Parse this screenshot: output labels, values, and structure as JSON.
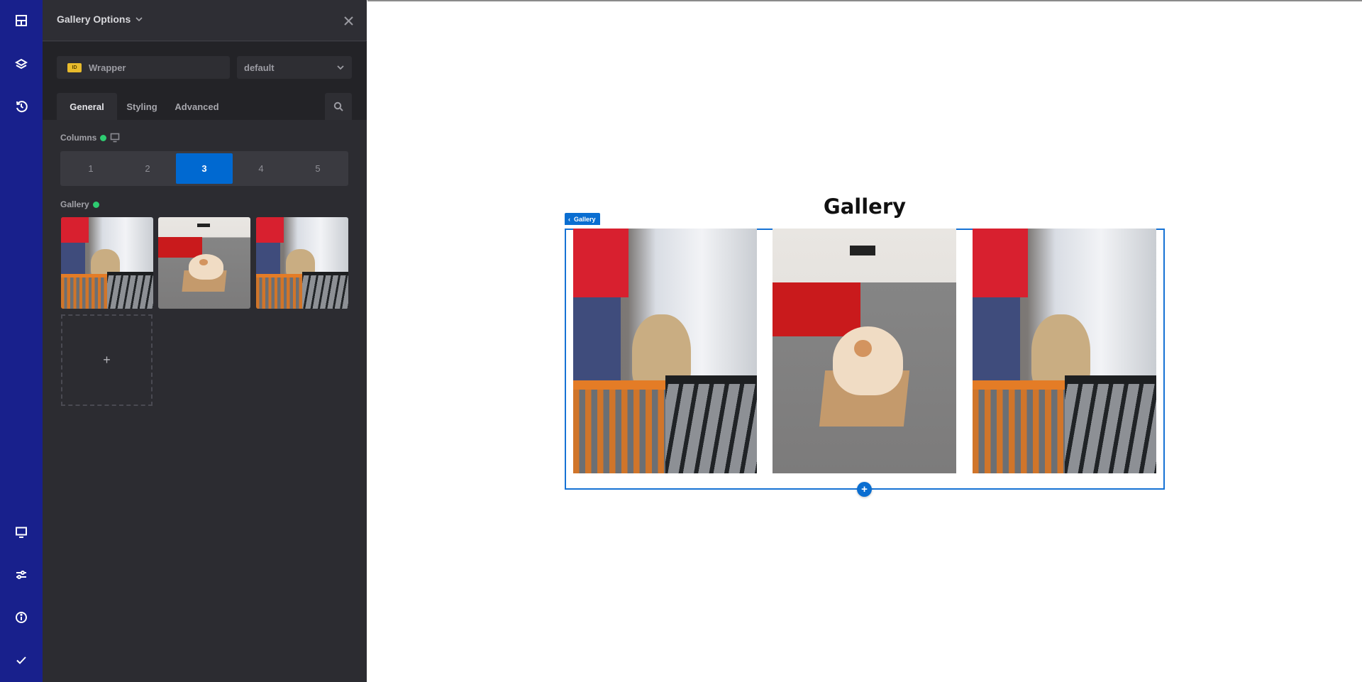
{
  "iconbar": {
    "top_items": [
      {
        "icon": "layout-grid-icon",
        "label": "Elements"
      },
      {
        "icon": "layers-icon",
        "label": "Layers"
      },
      {
        "icon": "history-icon",
        "label": "History"
      }
    ],
    "bottom_items": [
      {
        "icon": "monitor-icon",
        "label": "Responsive"
      },
      {
        "icon": "sliders-icon",
        "label": "Settings"
      },
      {
        "icon": "info-icon",
        "label": "Info"
      },
      {
        "icon": "check-icon",
        "label": "Save"
      }
    ],
    "color": "#18208c"
  },
  "panel": {
    "title": "Gallery Options",
    "id_badge": "ID",
    "element_name": "Wrapper",
    "style_select": "default",
    "tabs": [
      {
        "label": "General",
        "active": true
      },
      {
        "label": "Styling",
        "active": false
      },
      {
        "label": "Advanced",
        "active": false
      }
    ],
    "columns": {
      "label": "Columns",
      "options": [
        "1",
        "2",
        "3",
        "4",
        "5"
      ],
      "selected": "3"
    },
    "gallery": {
      "label": "Gallery",
      "images": [
        {
          "subject": "dog-with-glasses-at-gate"
        },
        {
          "subject": "cat-in-cardboard-box"
        },
        {
          "subject": "dog-with-glasses-at-gate"
        }
      ],
      "add_label": "+"
    }
  },
  "canvas": {
    "heading": "Gallery",
    "element_label": "Gallery",
    "add_below": "+",
    "accent": "#0a6ed1"
  }
}
